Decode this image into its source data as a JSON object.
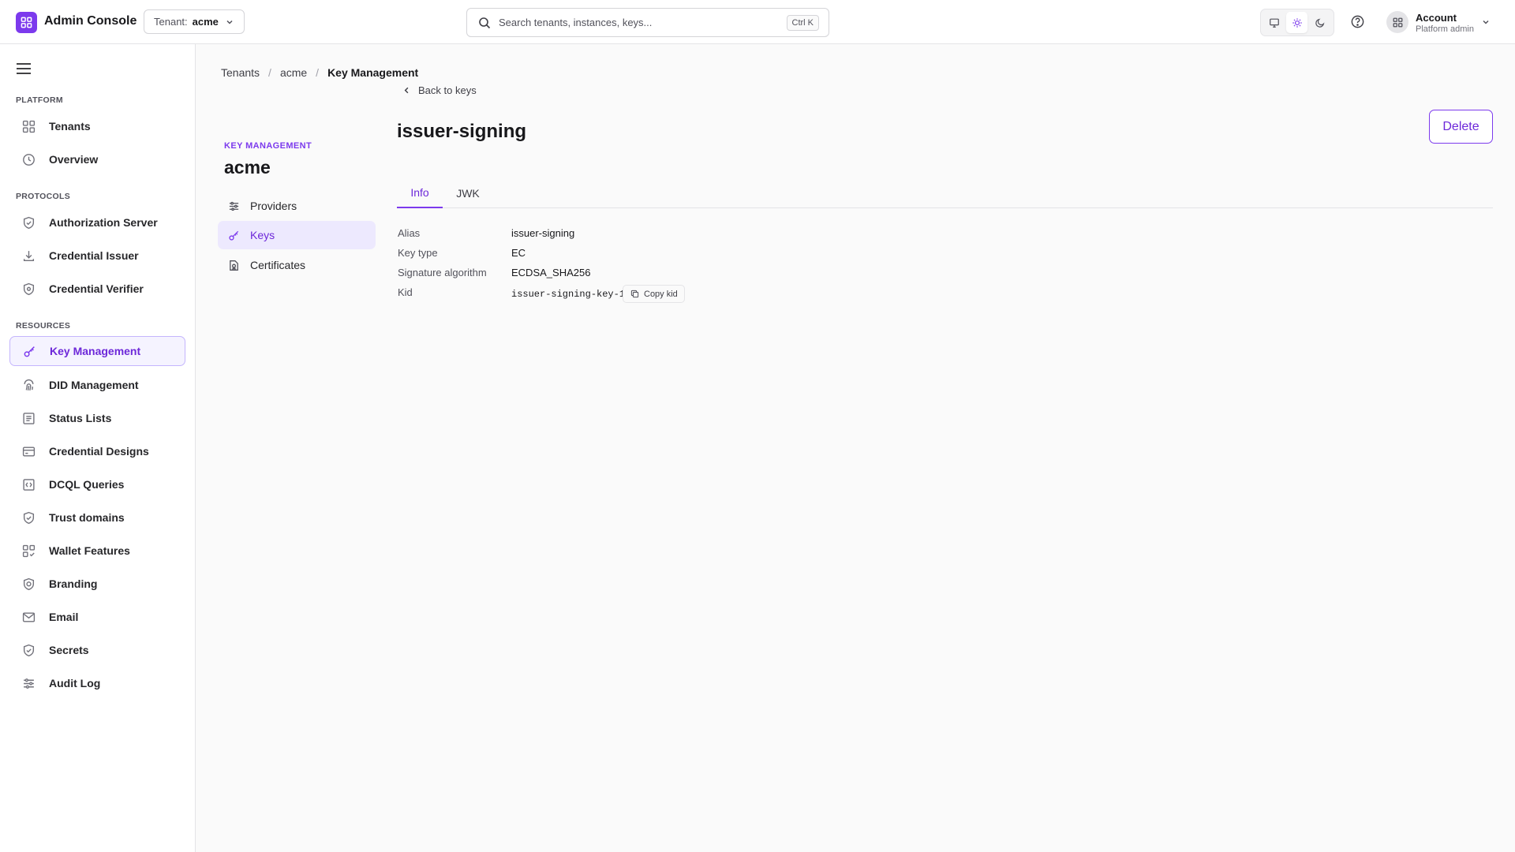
{
  "header": {
    "app_title": "Admin Console",
    "tenant_label": "Tenant:",
    "tenant_value": "acme",
    "search_placeholder": "Search tenants, instances, keys...",
    "search_shortcut": "Ctrl K",
    "account_name": "Account",
    "account_role": "Platform admin"
  },
  "sidebar": {
    "sections": {
      "platform": "PLATFORM",
      "protocols": "PROTOCOLS",
      "resources": "RESOURCES"
    },
    "items": {
      "tenants": "Tenants",
      "overview": "Overview",
      "authorization_server": "Authorization Server",
      "credential_issuer": "Credential Issuer",
      "credential_verifier": "Credential Verifier",
      "key_management": "Key Management",
      "did_management": "DID Management",
      "status_lists": "Status Lists",
      "credential_designs": "Credential Designs",
      "dcql_queries": "DCQL Queries",
      "trust_domains": "Trust domains",
      "wallet_features": "Wallet Features",
      "branding": "Branding",
      "email": "Email",
      "secrets": "Secrets",
      "audit_log": "Audit Log"
    },
    "active": "key_management"
  },
  "breadcrumb": {
    "tenants": "Tenants",
    "tenant": "acme",
    "current": "Key Management"
  },
  "subnav": {
    "eyebrow": "KEY MANAGEMENT",
    "title": "acme",
    "providers": "Providers",
    "keys": "Keys",
    "certificates": "Certificates",
    "active": "keys"
  },
  "detail": {
    "back_label": "Back to keys",
    "title": "issuer-signing",
    "delete_label": "Delete",
    "tabs": {
      "info": "Info",
      "jwk": "JWK",
      "active": "info"
    },
    "fields": {
      "alias_label": "Alias",
      "alias_value": "issuer-signing",
      "key_type_label": "Key type",
      "key_type_value": "EC",
      "signature_algorithm_label": "Signature algorithm",
      "signature_algorithm_value": "ECDSA_SHA256",
      "kid_label": "Kid",
      "kid_value": "issuer-signing-key-1",
      "copy_kid_label": "Copy kid"
    }
  },
  "colors": {
    "accent": "#7c3aed",
    "accent_text": "#6d28d9",
    "active_bg": "#f5f3ff",
    "border": "#e4e4e7"
  }
}
